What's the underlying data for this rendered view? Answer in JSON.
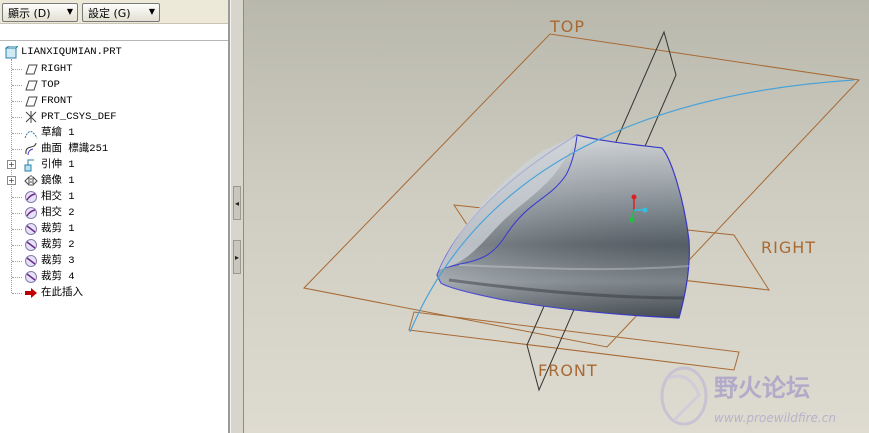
{
  "toolbar": {
    "show_label": "顯示 (D)",
    "settings_label": "設定 (G)"
  },
  "tree": {
    "root": "LIANXIQUMIAN.PRT",
    "items": [
      {
        "label": "RIGHT",
        "icon": "datum-plane-icon"
      },
      {
        "label": "TOP",
        "icon": "datum-plane-icon"
      },
      {
        "label": "FRONT",
        "icon": "datum-plane-icon"
      },
      {
        "label": "PRT_CSYS_DEF",
        "icon": "csys-icon"
      },
      {
        "label": "草繪 1",
        "icon": "sketch-icon"
      },
      {
        "label": "曲面 標識251",
        "icon": "surface-icon"
      },
      {
        "label": "引伸 1",
        "icon": "extrude-icon"
      },
      {
        "label": "鏡像 1",
        "icon": "mirror-icon"
      },
      {
        "label": "相交 1",
        "icon": "intersect-icon"
      },
      {
        "label": "相交 2",
        "icon": "intersect-icon"
      },
      {
        "label": "裁剪 1",
        "icon": "trim-icon"
      },
      {
        "label": "裁剪 2",
        "icon": "trim-icon"
      },
      {
        "label": "裁剪 3",
        "icon": "trim-icon"
      },
      {
        "label": "裁剪 4",
        "icon": "trim-icon"
      },
      {
        "label": "在此插入",
        "icon": "insert-here-arrow-icon"
      }
    ]
  },
  "viewport": {
    "datum_top": "TOP",
    "datum_right": "RIGHT",
    "datum_front": "FRONT",
    "watermark_cn": "野火论坛",
    "watermark_url": "www.proewildfire.cn"
  },
  "colors": {
    "datum": "#a86a34",
    "curve": "#4aa3d8",
    "surface_edge": "#3b3bd0",
    "insert_arrow": "#c00000"
  }
}
